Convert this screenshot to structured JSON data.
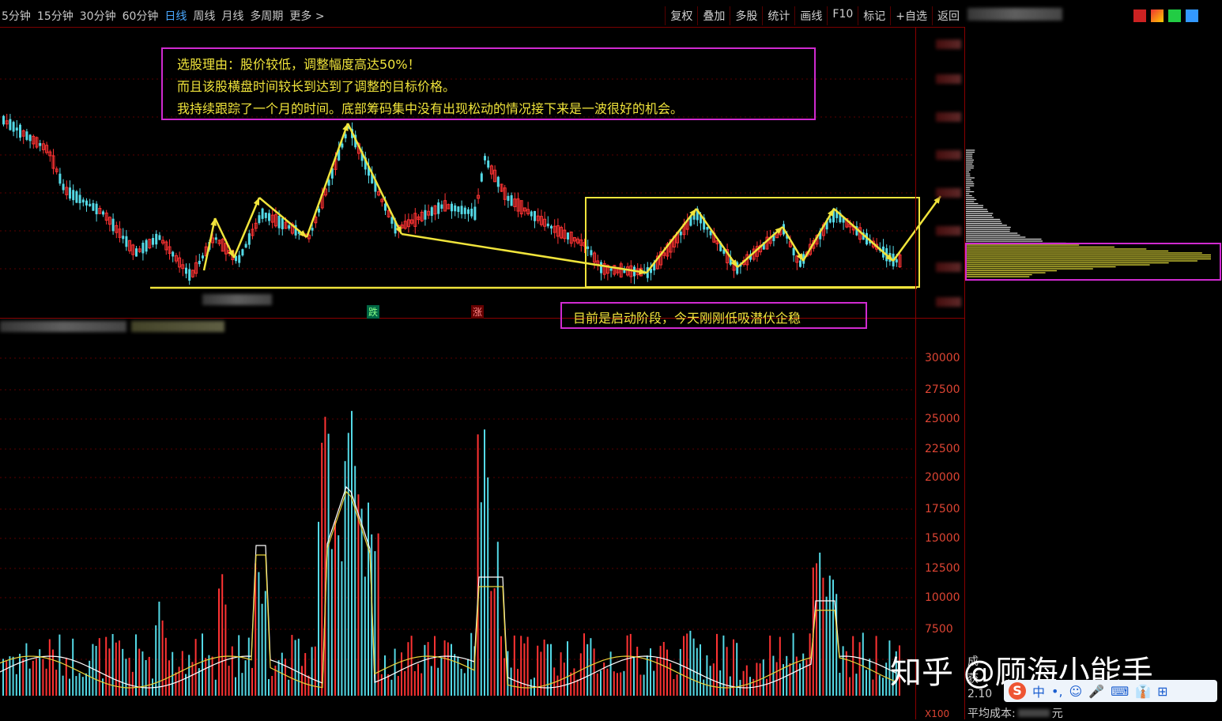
{
  "toolbar": {
    "periods": [
      "5分钟",
      "15分钟",
      "30分钟",
      "60分钟",
      "日线",
      "周线",
      "月线",
      "多周期",
      "更多 >"
    ],
    "active_period": "日线",
    "actions": [
      "复权",
      "叠加",
      "多股",
      "统计",
      "画线",
      "F10",
      "标记",
      "+自选",
      "返回"
    ]
  },
  "annotations": {
    "reason_lines": [
      "选股理由：股价较低，调整幅度高达50%！",
      "而且该股横盘时间较长到达到了调整的目标价格。",
      "我持续跟踪了一个月的时间。底部筹码集中没有出现松动的情况接下来是一波很好的机会。"
    ],
    "current_stage": "目前是启动阶段，今天刚刚低吸潜伏企稳"
  },
  "markers": {
    "down": "跌",
    "up": "涨"
  },
  "volume_axis": {
    "ticks": [
      "30000",
      "27500",
      "25000",
      "22500",
      "20000",
      "17500",
      "15000",
      "12500",
      "10000",
      "7500"
    ],
    "unit": "X100"
  },
  "side_panel": {
    "cost_label": "平均成本:",
    "cost_suffix": "元",
    "value_prefix": "2.10",
    "profit_label": "获",
    "dist_label": "成"
  },
  "watermark": "知乎 @顾海小能手",
  "ime": {
    "items": [
      "中",
      "•,",
      "☺",
      "🎤",
      "⌨",
      "👔",
      "⊞"
    ]
  },
  "colors": {
    "up": "#ff3333",
    "down": "#54d9e6",
    "annotation": "#f0e43b",
    "box": "#d02ad0",
    "grid": "#8a0000"
  }
}
